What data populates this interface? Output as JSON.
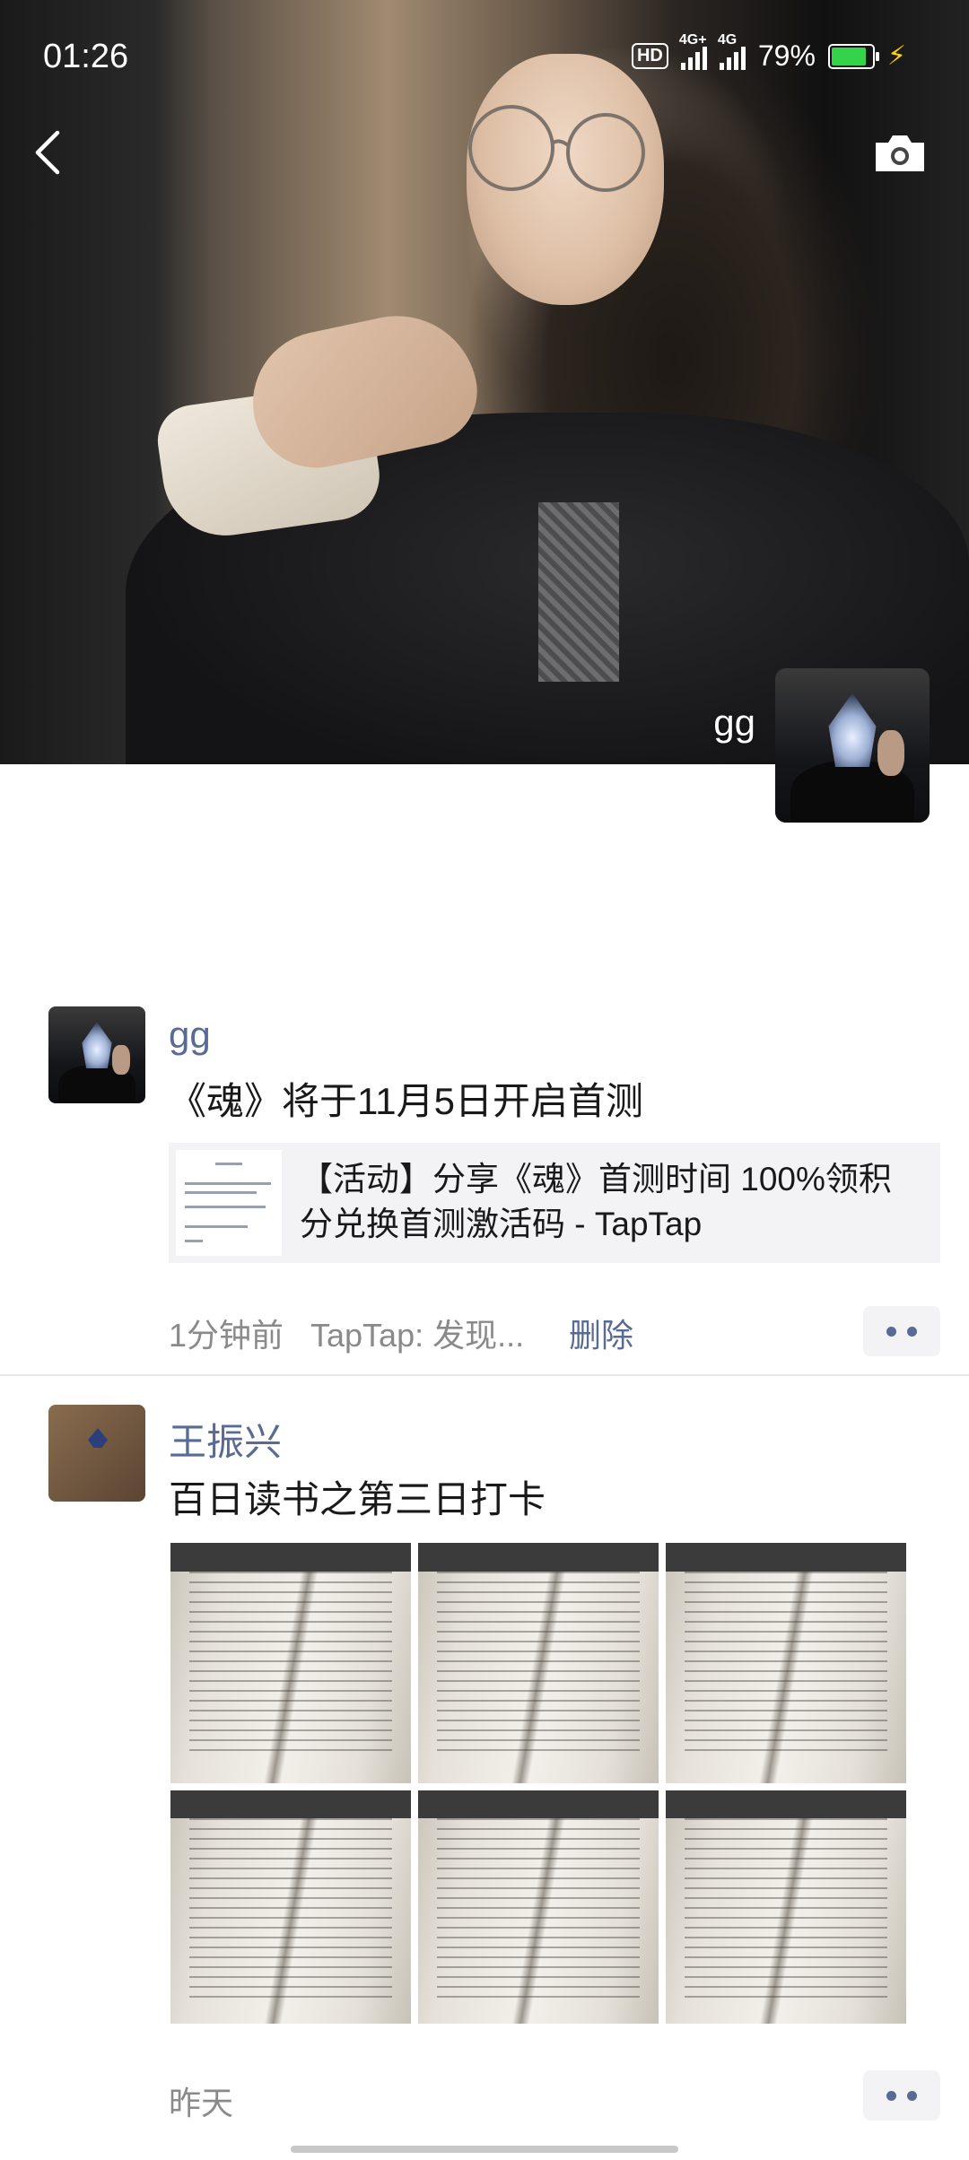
{
  "status_bar": {
    "time": "01:26",
    "hd_label": "HD",
    "network_1": "4G+",
    "network_2": "4G",
    "battery_percent": "79%",
    "battery_level": 0.79
  },
  "header": {
    "owner_name": "gg"
  },
  "posts": [
    {
      "author": "gg",
      "text": "《魂》将于11月5日开启首测",
      "share": {
        "title": "【活动】分享《魂》首测时间 100%领积分兑换首测激活码 - TapTap"
      },
      "time": "1分钟前",
      "source": "TapTap: 发现...",
      "delete_label": "删除"
    },
    {
      "author": "王振兴",
      "text": "百日读书之第三日打卡",
      "photo_count": 6,
      "time": "昨天"
    }
  ],
  "icons": {
    "back": "chevron-left-icon",
    "camera": "camera-icon",
    "more": "more-dots-icon"
  },
  "colors": {
    "nickname": "#576b95",
    "meta_text": "#8a8a8a",
    "battery_fill": "#35d34a",
    "charging_bolt": "#ffd400"
  }
}
